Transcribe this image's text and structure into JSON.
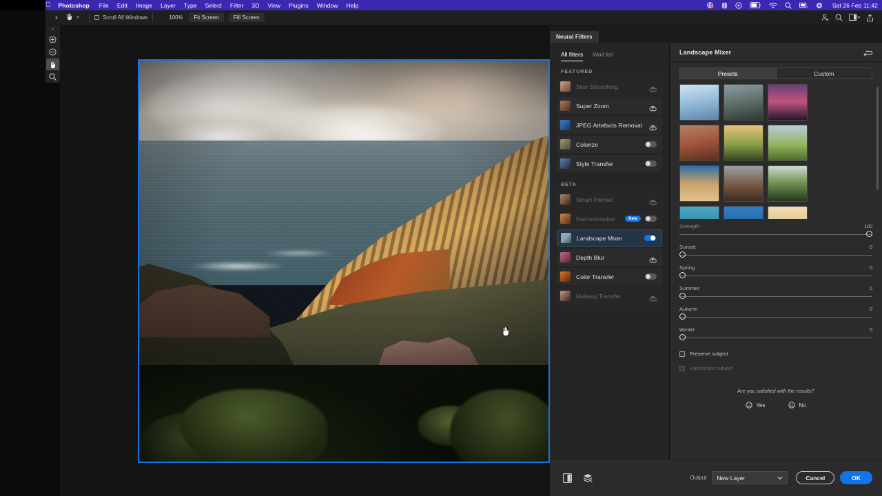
{
  "menubar": {
    "apple_icon": "apple-logo-icon",
    "items": [
      {
        "label": "Photoshop",
        "bold": true
      },
      {
        "label": "File"
      },
      {
        "label": "Edit"
      },
      {
        "label": "Image"
      },
      {
        "label": "Layer"
      },
      {
        "label": "Type"
      },
      {
        "label": "Select"
      },
      {
        "label": "Filter"
      },
      {
        "label": "3D"
      },
      {
        "label": "View"
      },
      {
        "label": "Plugins"
      },
      {
        "label": "Window"
      },
      {
        "label": "Help"
      }
    ],
    "status_icons": [
      "screen-sharing-icon",
      "siri-shortcuts-icon",
      "timemachine-icon",
      "battery-icon",
      "wifi-icon",
      "spotlight-search-icon",
      "display-icon",
      "control-center-icon"
    ],
    "clock": "Sat 26 Feb  11:42",
    "accent_color": "#3a28b0"
  },
  "options_bar": {
    "back_icon": "chevron-left-icon",
    "tool_icon": "hand-tool-icon",
    "preset_caret_icon": "chevron-down-icon",
    "scroll_all_windows_label": "Scroll All Windows",
    "zoom_level": "100%",
    "fit_screen_label": "Fit Screen",
    "fill_screen_label": "Fill Screen",
    "right_icons": [
      "share-document-icon",
      "search-icon",
      "workspace-icon",
      "export-icon"
    ]
  },
  "toolbar": {
    "grip_icon": "panel-grip-icon",
    "tools": [
      {
        "name": "zoom-in-tool",
        "icon": "plus-circle-icon",
        "active": false
      },
      {
        "name": "zoom-out-tool",
        "icon": "minus-circle-icon",
        "active": false
      },
      {
        "name": "hand-tool",
        "icon": "hand-icon",
        "active": true
      },
      {
        "name": "zoom-tool",
        "icon": "magnifier-icon",
        "active": false
      }
    ]
  },
  "canvas": {
    "cursor_icon": "hand-cursor-icon",
    "selection_border_color": "#1473e6",
    "image_description": "Coastal valley landscape at sunset with ocean, sunlit ridges and green foreground"
  },
  "neural_filters": {
    "panel_tab": "Neural Filters",
    "subtabs": [
      {
        "label": "All filters",
        "active": true
      },
      {
        "label": "Wait list",
        "active": false
      }
    ],
    "sections": [
      {
        "heading": "FEATURED",
        "filters": [
          {
            "label": "Skin Smoothing",
            "control": "download",
            "enabled": false,
            "muted": true,
            "thumb_from": "#caa189",
            "thumb_to": "#6b4b38"
          },
          {
            "label": "Super Zoom",
            "control": "download",
            "enabled": false,
            "muted": false,
            "thumb_from": "#b2785a",
            "thumb_to": "#4a2f23"
          },
          {
            "label": "JPEG Artefacts Removal",
            "control": "download",
            "enabled": false,
            "muted": false,
            "thumb_from": "#3a7fd5",
            "thumb_to": "#16345e"
          },
          {
            "label": "Colorize",
            "control": "toggle",
            "enabled": false,
            "muted": false,
            "thumb_from": "#9a9a72",
            "thumb_to": "#4c4c34"
          },
          {
            "label": "Style Transfer",
            "control": "toggle",
            "enabled": false,
            "muted": false,
            "thumb_from": "#5f7fae",
            "thumb_to": "#1e2a3c"
          }
        ]
      },
      {
        "heading": "BETA",
        "filters": [
          {
            "label": "Smart Portrait",
            "control": "download",
            "enabled": false,
            "muted": true,
            "thumb_from": "#b08a6a",
            "thumb_to": "#3d2b1d"
          },
          {
            "label": "Harmonization",
            "control": "toggle",
            "enabled": false,
            "muted": true,
            "badge": "New",
            "thumb_from": "#d08a4a",
            "thumb_to": "#5b2f16"
          },
          {
            "label": "Landscape Mixer",
            "control": "toggle",
            "enabled": true,
            "muted": false,
            "selected": true,
            "thumb_from": "#8fa4b5",
            "thumb_to": "#3e5a3c"
          },
          {
            "label": "Depth Blur",
            "control": "download",
            "enabled": false,
            "muted": false,
            "thumb_from": "#c06a8a",
            "thumb_to": "#59263a"
          },
          {
            "label": "Color Transfer",
            "control": "toggle",
            "enabled": false,
            "muted": false,
            "thumb_from": "#e07a28",
            "thumb_to": "#5a2408"
          },
          {
            "label": "Makeup Transfer",
            "control": "download",
            "enabled": false,
            "muted": true,
            "thumb_from": "#c49b86",
            "thumb_to": "#3a2319"
          }
        ]
      }
    ]
  },
  "landscape_mixer": {
    "title": "Landscape Mixer",
    "reset_icon": "reset-arrow-icon",
    "tabs": [
      {
        "label": "Presets",
        "active": true
      },
      {
        "label": "Custom",
        "active": false
      }
    ],
    "presets": [
      {
        "name": "glacier-ice",
        "from": "#cfe3f2",
        "via": "#8fb9d8",
        "to": "#5d86a6"
      },
      {
        "name": "alpine-lake",
        "from": "#8d9aa4",
        "via": "#5e6f6b",
        "to": "#2e3a32"
      },
      {
        "name": "purple-sunset-reflection",
        "from": "#6b3f7a",
        "via": "#c0547e",
        "to": "#2b1630"
      },
      {
        "name": "red-canyon",
        "from": "#b2836a",
        "via": "#a0543a",
        "to": "#58301f"
      },
      {
        "name": "golden-valley",
        "from": "#e8c27a",
        "via": "#8aa04a",
        "to": "#33441f"
      },
      {
        "name": "green-meadow",
        "from": "#b8cbda",
        "via": "#93b45c",
        "to": "#4c6a2c"
      },
      {
        "name": "desert-beach-cliff",
        "from": "#2f6ea8",
        "via": "#c9a06a",
        "to": "#e3c48c"
      },
      {
        "name": "monument-buttes",
        "from": "#9aa0a4",
        "via": "#7a5a48",
        "to": "#3b2a22"
      },
      {
        "name": "river-gorge",
        "from": "#cfd8d0",
        "via": "#6d8f4e",
        "to": "#24381c"
      },
      {
        "name": "tropical-shore",
        "from": "#49a8c4",
        "via": "#2f8fae",
        "to": "#1f6f8c"
      },
      {
        "name": "blue-lake",
        "from": "#2f7fc4",
        "via": "#2a6fae",
        "to": "#1e5286"
      },
      {
        "name": "sand-dunes",
        "from": "#f0ddb2",
        "via": "#e3c98e",
        "to": "#cfae6d"
      }
    ],
    "sliders": [
      {
        "label": "Strength",
        "value": "100",
        "percent": 100,
        "dim": true
      },
      {
        "label": "Sunset",
        "value": "0",
        "percent": 0,
        "dim": false
      },
      {
        "label": "Spring",
        "value": "0",
        "percent": 0,
        "dim": false
      },
      {
        "label": "Summer",
        "value": "0",
        "percent": 0,
        "dim": false
      },
      {
        "label": "Autumn",
        "value": "0",
        "percent": 0,
        "dim": false
      },
      {
        "label": "Winter",
        "value": "0",
        "percent": 0,
        "dim": false
      }
    ],
    "checkboxes": [
      {
        "label": "Preserve subject",
        "checked": false,
        "disabled": false
      },
      {
        "label": "Harmonize subject",
        "checked": false,
        "disabled": true
      }
    ],
    "satisfaction_question": "Are you satisfied with the results?",
    "yes_label": "Yes",
    "no_label": "No",
    "yes_icon": "smiley-happy-icon",
    "no_icon": "smiley-sad-icon"
  },
  "bottom_bar": {
    "compare_icon": "split-preview-icon",
    "layers_icon": "layers-stack-icon",
    "output_label": "Output",
    "output_value": "New Layer",
    "output_caret_icon": "chevron-down-icon",
    "cancel_label": "Cancel",
    "ok_label": "OK",
    "ok_color": "#1473e6"
  }
}
